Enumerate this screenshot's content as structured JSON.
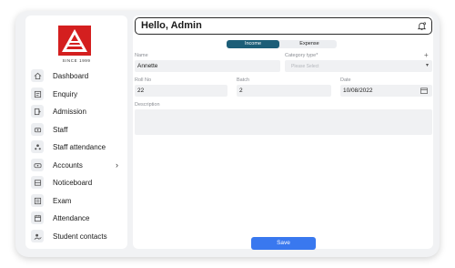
{
  "brand": {
    "since": "SINCE 1999",
    "logo_color": "#d41f1f"
  },
  "sidebar": {
    "items": [
      {
        "label": "Dashboard",
        "icon": "home-icon"
      },
      {
        "label": "Enquiry",
        "icon": "enquiry-icon"
      },
      {
        "label": "Admission",
        "icon": "admission-icon"
      },
      {
        "label": "Staff",
        "icon": "staff-icon"
      },
      {
        "label": "Staff attendance",
        "icon": "staff-attendance-icon"
      },
      {
        "label": "Accounts",
        "icon": "accounts-icon"
      },
      {
        "label": "Noticeboard",
        "icon": "noticeboard-icon"
      },
      {
        "label": "Exam",
        "icon": "exam-icon"
      },
      {
        "label": "Attendance",
        "icon": "attendance-icon"
      },
      {
        "label": "Student contacts",
        "icon": "contacts-icon"
      }
    ],
    "accounts_chevron": "›"
  },
  "header": {
    "title": "Hello, Admin",
    "icon": "bell-icon"
  },
  "toggle": {
    "income": "Income",
    "expense": "Expense",
    "active": "income",
    "active_color": "#1c5e78"
  },
  "form": {
    "name_label": "Name",
    "name_value": "Annette",
    "category_label": "Category type*",
    "category_placeholder": "Please Select",
    "roll_label": "Roll No",
    "roll_value": "22",
    "batch_label": "Batch",
    "batch_value": "2",
    "date_label": "Date",
    "date_value": "10/08/2022",
    "description_label": "Description",
    "description_value": ""
  },
  "actions": {
    "save": "Save",
    "save_color": "#3978ef"
  }
}
